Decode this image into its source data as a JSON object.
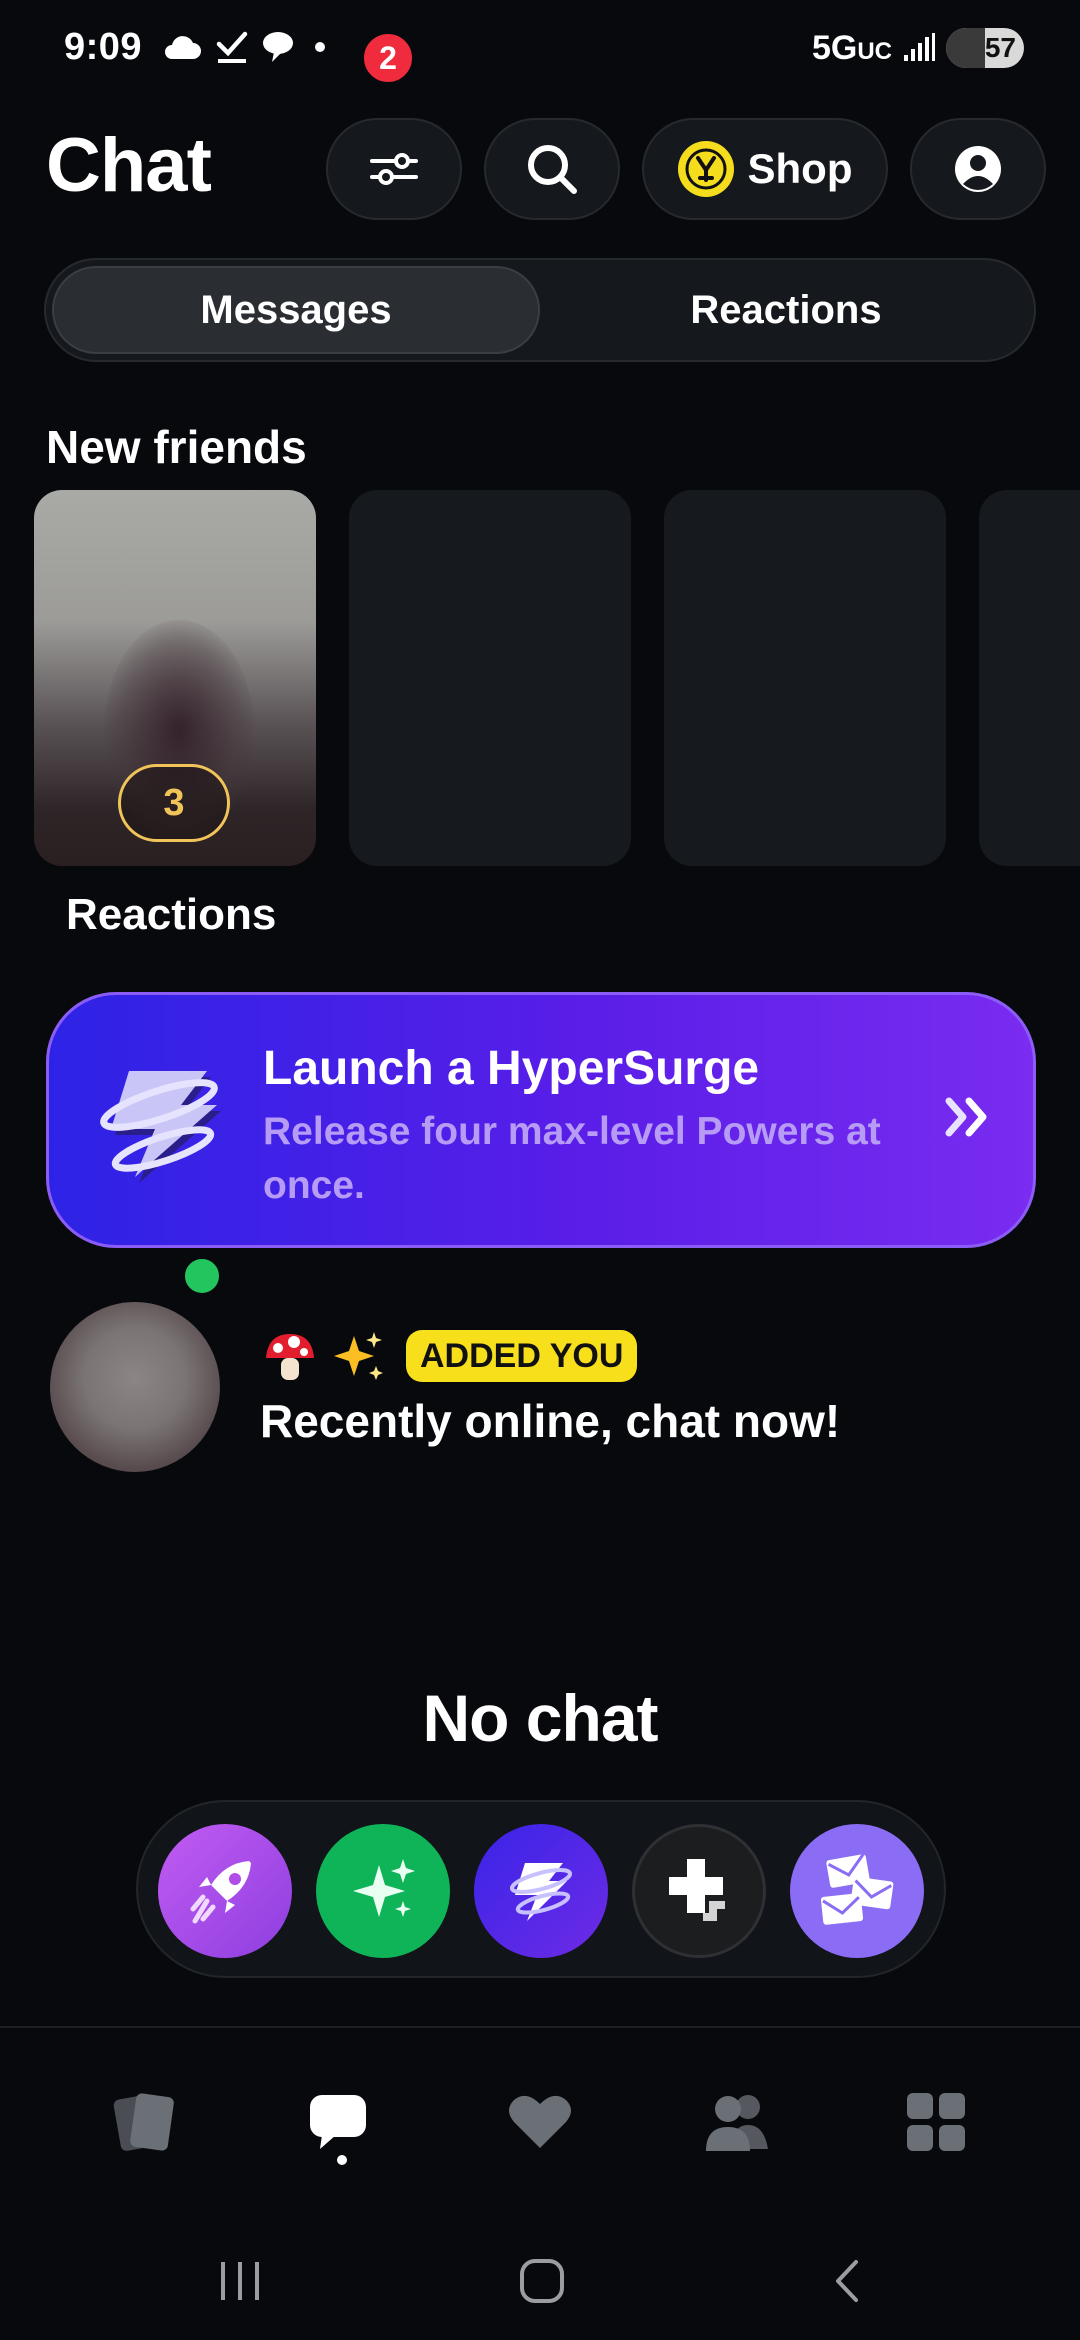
{
  "status_bar": {
    "time": "9:09",
    "network": "5G",
    "network_suffix": "UC",
    "battery": "57"
  },
  "header": {
    "title": "Chat",
    "shop_label": "Shop"
  },
  "tabs": {
    "messages": "Messages",
    "reactions": "Reactions"
  },
  "new_friends": {
    "title": "New friends",
    "first_card_count": "3",
    "first_card_caption": "Reactions"
  },
  "promo": {
    "title": "Launch a HyperSurge",
    "subtitle": "Release four max-level Powers at once."
  },
  "friend_row": {
    "badge": "ADDED YOU",
    "message": "Recently online, chat now!",
    "emojis": [
      "mushroom-emoji",
      "sparkles-emoji"
    ]
  },
  "empty_state": {
    "title": "No chat"
  },
  "powers": [
    "rocket-power",
    "sparkle-power",
    "hypersurge-power",
    "plus-power",
    "envelopes-power"
  ],
  "bottom_nav": {
    "items": [
      "cards-icon",
      "chat-icon",
      "heart-icon",
      "friends-icon",
      "grid-icon"
    ],
    "chat_badge": "2"
  },
  "colors": {
    "background": "#07090c",
    "promo_start": "#2d23e6",
    "promo_end": "#7a2cf0",
    "badge_yellow": "#f8df1c",
    "online_green": "#22c55e",
    "notification_red": "#ef2b3d"
  }
}
